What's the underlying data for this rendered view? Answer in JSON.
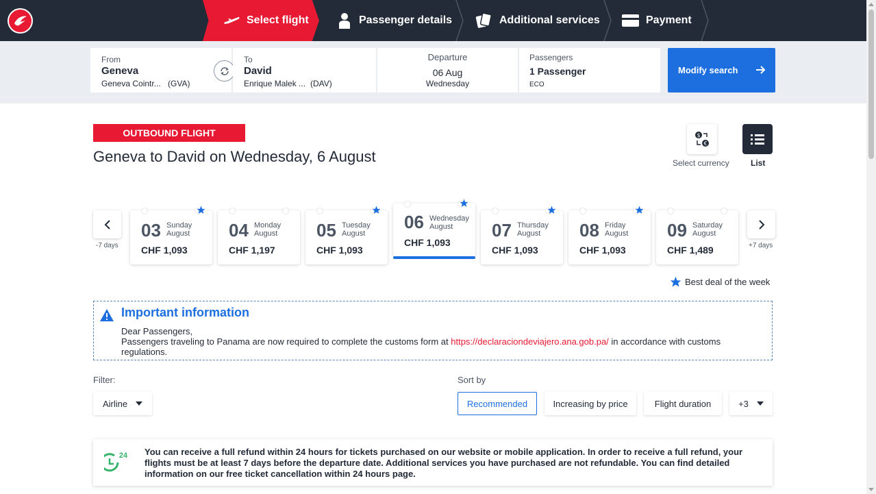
{
  "nav": {
    "steps": [
      {
        "label": "Select flight",
        "icon": "plane-icon",
        "active": true
      },
      {
        "label": "Passenger details",
        "icon": "person-icon",
        "active": false
      },
      {
        "label": "Additional services",
        "icon": "cards-icon",
        "active": false
      },
      {
        "label": "Payment",
        "icon": "card-icon",
        "active": false
      }
    ],
    "brand_color": "#e81932",
    "bg_color": "#232b38"
  },
  "search": {
    "from_label": "From",
    "from_city": "Geneva",
    "from_airport": "Geneva Cointr...",
    "from_code": "(GVA)",
    "to_label": "To",
    "to_city": "David",
    "to_airport": "Enrique Malek ...",
    "to_code": "(DAV)",
    "departure_label": "Departure",
    "departure_date": "06 Aug",
    "departure_day": "Wednesday",
    "passengers_label": "Passengers",
    "passengers_value": "1 Passenger",
    "cabin": "ECO",
    "modify_label": "Modify search",
    "accent_color": "#1d6fe0"
  },
  "outbound": {
    "badge": "OUTBOUND FLIGHT",
    "title": "Geneva to David on Wednesday, 6 August",
    "currency_label": "Select currency",
    "list_label": "List"
  },
  "dates": {
    "prev_label": "-7 days",
    "next_label": "+7 days",
    "cards": [
      {
        "day": "03",
        "weekday": "Sunday",
        "month": "August",
        "price": "CHF 1,093",
        "best": true,
        "selected": false
      },
      {
        "day": "04",
        "weekday": "Monday",
        "month": "August",
        "price": "CHF 1,197",
        "best": false,
        "selected": false
      },
      {
        "day": "05",
        "weekday": "Tuesday",
        "month": "August",
        "price": "CHF 1,093",
        "best": true,
        "selected": false
      },
      {
        "day": "06",
        "weekday": "Wednesday",
        "month": "August",
        "price": "CHF 1,093",
        "best": true,
        "selected": true
      },
      {
        "day": "07",
        "weekday": "Thursday",
        "month": "August",
        "price": "CHF 1,093",
        "best": true,
        "selected": false
      },
      {
        "day": "08",
        "weekday": "Friday",
        "month": "August",
        "price": "CHF 1,093",
        "best": true,
        "selected": false
      },
      {
        "day": "09",
        "weekday": "Saturday",
        "month": "August",
        "price": "CHF 1,489",
        "best": false,
        "selected": false
      }
    ],
    "best_deal_label": "Best deal of the week"
  },
  "info": {
    "title": "Important information",
    "greeting": "Dear Passengers,",
    "text_before": "Passengers traveling to Panama are now required to complete the customs form at ",
    "link": "https://declaraciondeviajero.ana.gob.pa/",
    "text_after": " in accordance with customs regulations."
  },
  "filter": {
    "label": "Filter:",
    "airline": "Airline"
  },
  "sort": {
    "label": "Sort by",
    "options": [
      "Recommended",
      "Increasing by price",
      "Flight duration"
    ],
    "more": "+3"
  },
  "refund": {
    "icon_badge": "24",
    "text": "You can receive a full refund within 24 hours for tickets purchased on our website or mobile application. In order to receive a full refund, your flights must be at least 7 days before the departure date. Additional services you have purchased are not refundable. You can find detailed information on our free ticket cancellation within 24 hours page."
  }
}
